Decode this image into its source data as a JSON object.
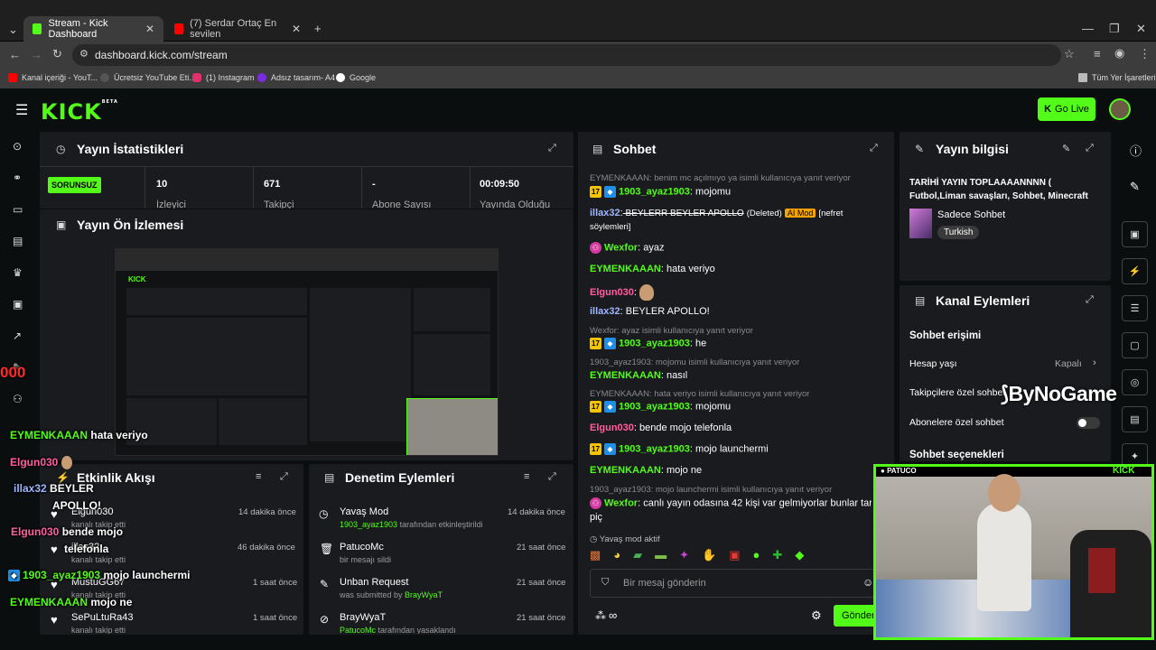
{
  "browser": {
    "tabs": [
      {
        "title": "Stream - Kick Dashboard",
        "active": true
      },
      {
        "title": "(7) Serdar Ortaç En sevilen",
        "active": false
      }
    ],
    "url": "dashboard.kick.com/stream",
    "bookmarks": [
      "Kanal içeriği - YouT...",
      "Ücretsiz YouTube Eti...",
      "(1) Instagram",
      "Adsız tasarım- A4",
      "Google"
    ],
    "all_bookmarks_label": "Tüm Yer İşaretleri"
  },
  "header": {
    "logo": "KICK",
    "logo_beta": "BETA",
    "go_live_label": "Go Live",
    "accent": "#53fc18"
  },
  "stats": {
    "title": "Yayın İstatistikleri",
    "status_badge": "SORUNSUZ",
    "items": [
      {
        "value": "10",
        "label": "İzleyici"
      },
      {
        "value": "671",
        "label": "Takipçi"
      },
      {
        "value": "-",
        "label": "Abone Sayısı"
      },
      {
        "value": "00:09:50",
        "label": "Yayında Olduğu"
      }
    ]
  },
  "preview": {
    "title": "Yayın Ön İzlemesi"
  },
  "chat": {
    "title": "Sohbet",
    "messages": [
      {
        "reply": "EYMENKAAAN: benim mc açılmıyo ya isimli kullanıcıya yanıt veriyor"
      },
      {
        "user": "1903_ayaz1903",
        "text": " mojomu"
      },
      {
        "user": "illax32",
        "text": " BEYLERR BEYLER APOLLO",
        "deleted": "(Deleted)",
        "tag": "AI Mod",
        "extra": "[nefret"
      },
      {
        "extra2": "söylemleri]"
      },
      {
        "user": "Wexfor",
        "text": " ayaz"
      },
      {
        "user": "EYMENKAAAN",
        "text": " hata veriyo"
      },
      {
        "user": "Elgun030",
        "text": ""
      },
      {
        "user": "illax32",
        "text": " BEYLER APOLLO!"
      },
      {
        "reply": "Wexfor: ayaz isimli kullanıcıya yanıt veriyor"
      },
      {
        "user": "1903_ayaz1903",
        "text": " he"
      },
      {
        "reply": "1903_ayaz1903: mojomu isimli kullanıcıya yanıt veriyor"
      },
      {
        "user": "EYMENKAAAN",
        "text": " nasıl"
      },
      {
        "reply": "EYMENKAAAN: hata veriyo isimli kullanıcıya yanıt veriyor"
      },
      {
        "user": "1903_ayaz1903",
        "text": " mojomu"
      },
      {
        "user": "Elgun030",
        "text": " bende mojo telefonla"
      },
      {
        "user": "1903_ayaz1903",
        "text": " mojo launchermi"
      },
      {
        "user": "EYMENKAAAN",
        "text": " mojo ne"
      },
      {
        "reply": "1903_ayaz1903: mojo launchermi isimli kullanıcıya yanıt veriyor"
      },
      {
        "user": "Wexfor",
        "text": " canlı yayın odasına 42 kişi var gelmiyorlar bunlar tar"
      },
      {
        "text": "piç"
      }
    ],
    "slow_mode": "Yavaş mod aktif",
    "input_placeholder": "Bir mesaj gönderin",
    "send_label": "Gönder"
  },
  "stream_info": {
    "title": "Yayın bilgisi",
    "stream_title": "TARİHİ YAYIN TOPLAAAANNNN (",
    "stream_title2": "Futbol,Liman savaşları, Sohbet, Minecraft",
    "category": "Sadece Sohbet",
    "language": "Turkish"
  },
  "channel_actions": {
    "title": "Kanal Eylemleri",
    "section": "Sohbet erişimi",
    "account_age_label": "Hesap yaşı",
    "account_age_value": "Kapalı",
    "followers_only": "Takipçilere özel sohbet",
    "subs_only": "Abonelere özel sohbet",
    "chat_options": "Sohbet seçenekleri"
  },
  "activity": {
    "title": "Etkinlik Akışı",
    "items": [
      {
        "name": "Elgun030",
        "sub": "kanalı takip etti",
        "time": "14 dakika önce"
      },
      {
        "name": "illax32",
        "sub": "kanalı takip etti",
        "time": "46 dakika önce"
      },
      {
        "name": "MustuGG67",
        "sub": "kanalı takip etti",
        "time": "1 saat önce"
      },
      {
        "name": "SePuLtuRa43",
        "sub": "kanalı takip etti",
        "time": "1 saat önce"
      }
    ]
  },
  "moderation": {
    "title": "Denetim Eylemleri",
    "items": [
      {
        "name": "Yavaş Mod",
        "sub_user": "1903_ayaz1903",
        "sub": " tarafından etkinleştirildi",
        "time": "14 dakika önce"
      },
      {
        "name": "PatucoMc",
        "sub_user": "",
        "sub": "bir mesajı sildi",
        "time": "21 saat önce"
      },
      {
        "name": "Unban Request",
        "sub_user": "",
        "sub": "was submitted by ",
        "sub_user2": "BrayWyaT",
        "time": "21 saat önce"
      },
      {
        "name": "BrayWyaT",
        "sub_user": "PatucoMc",
        "sub": " tarafından yasaklandı",
        "time": "21 saat önce"
      }
    ]
  },
  "overlay_chat": [
    {
      "user": "EYMENKAAAN",
      "text": "hata veriyo"
    },
    {
      "user": "Elgun030",
      "text": ""
    },
    {
      "user": "illax32",
      "text": "BEYLER"
    },
    {
      "user": "",
      "text": "APOLLO!"
    },
    {
      "user": "Elgun030",
      "text": "bende mojo"
    },
    {
      "user": "",
      "text": "telefonla"
    },
    {
      "user": "1903_ayaz1903",
      "text": "mojo launchermi"
    },
    {
      "user": "EYMENKAAAN",
      "text": "mojo ne"
    }
  ],
  "overlay_counter": "000",
  "watermark": "ByNoGame",
  "webcam": {
    "name": "PATUCO",
    "brand": "KICK"
  }
}
